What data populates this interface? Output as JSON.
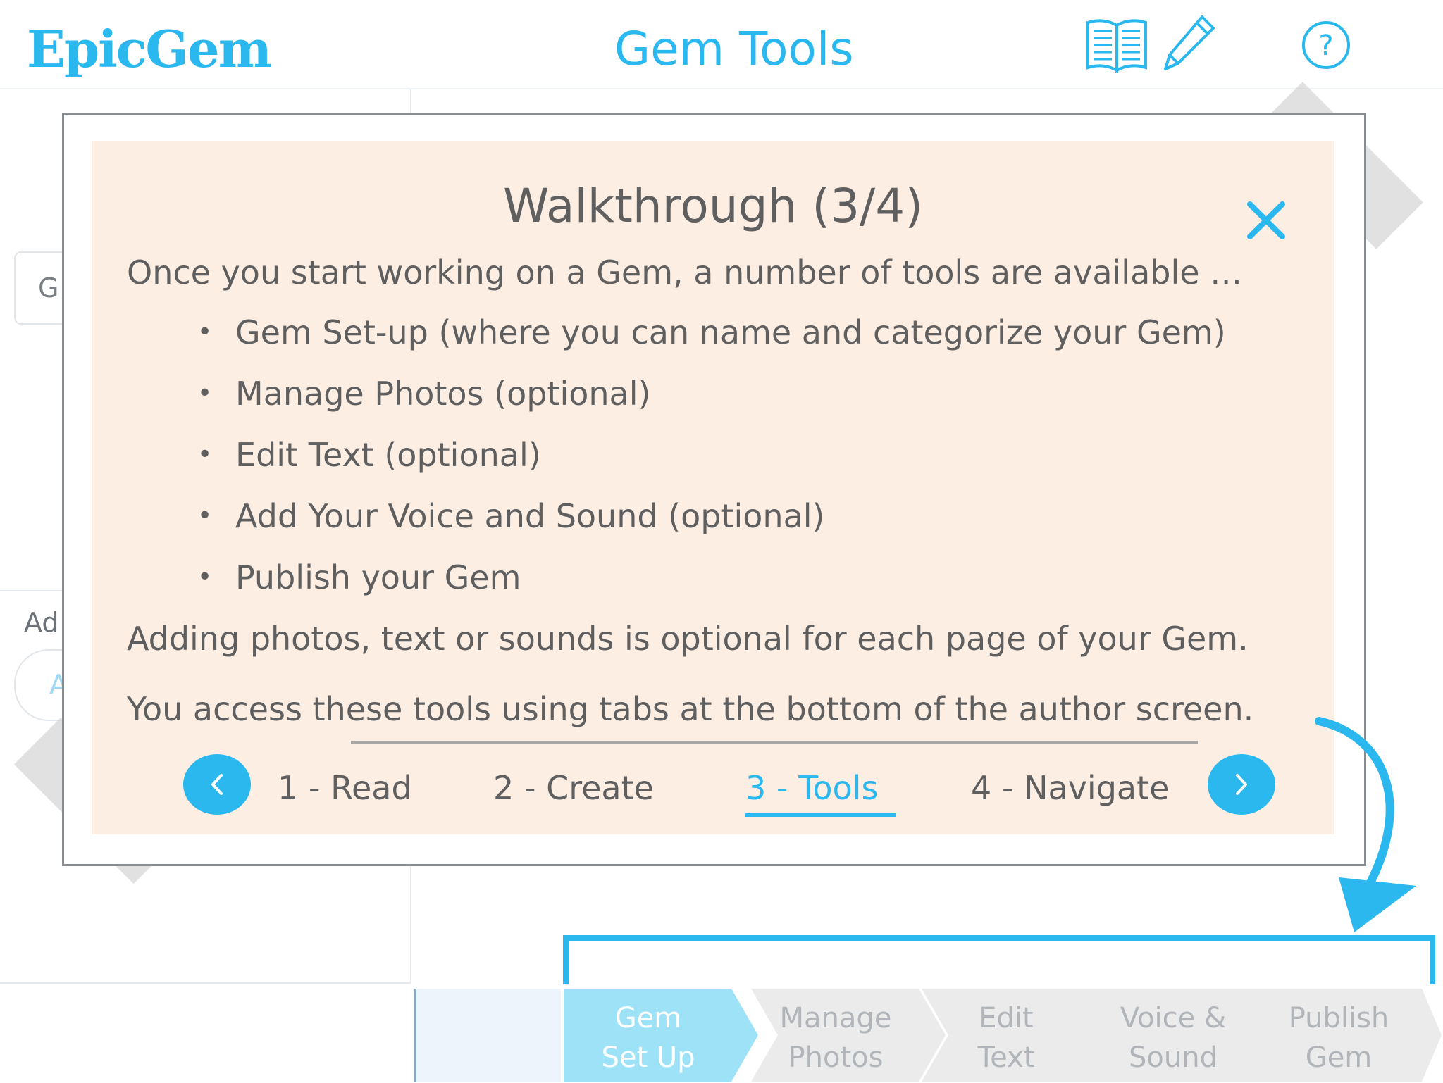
{
  "header": {
    "logo": "EpicGem",
    "title": "Gem Tools",
    "icons": [
      "book-icon",
      "pencil-icon",
      "help-icon"
    ]
  },
  "background": {
    "left_field_partial": "G",
    "left_label_partial": "Ad",
    "left_button_partial": "A"
  },
  "modal": {
    "title": "Walkthrough (3/4)",
    "intro": "Once you start working on a Gem, a number of tools are available …",
    "bullets": [
      "Gem Set-up (where you can name and categorize your Gem)",
      "Manage Photos (optional)",
      "Edit Text (optional)",
      "Add Your Voice and Sound (optional)",
      "Publish your Gem"
    ],
    "note1": "Adding photos, text or sounds is optional for each page of your Gem.",
    "note2": "You access these tools using tabs at the bottom of the author screen.",
    "steps": [
      "1 - Read",
      "2 - Create",
      "3 - Tools",
      "4 - Navigate"
    ],
    "current_step": 3,
    "progress_fraction": 0.75
  },
  "tabs": [
    {
      "label": "Gem\nSet Up",
      "active": true
    },
    {
      "label": "Manage\nPhotos",
      "active": false
    },
    {
      "label": "Edit\nText",
      "active": false
    },
    {
      "label": "Voice &\nSound",
      "active": false
    },
    {
      "label": "Publish\nGem",
      "active": false
    }
  ],
  "colors": {
    "accent": "#2ab8ee",
    "modal_bg": "#fdeee4",
    "text": "#5f5f5f",
    "tab_active": "#9ee2f8",
    "tab_inactive": "#ebebeb"
  }
}
